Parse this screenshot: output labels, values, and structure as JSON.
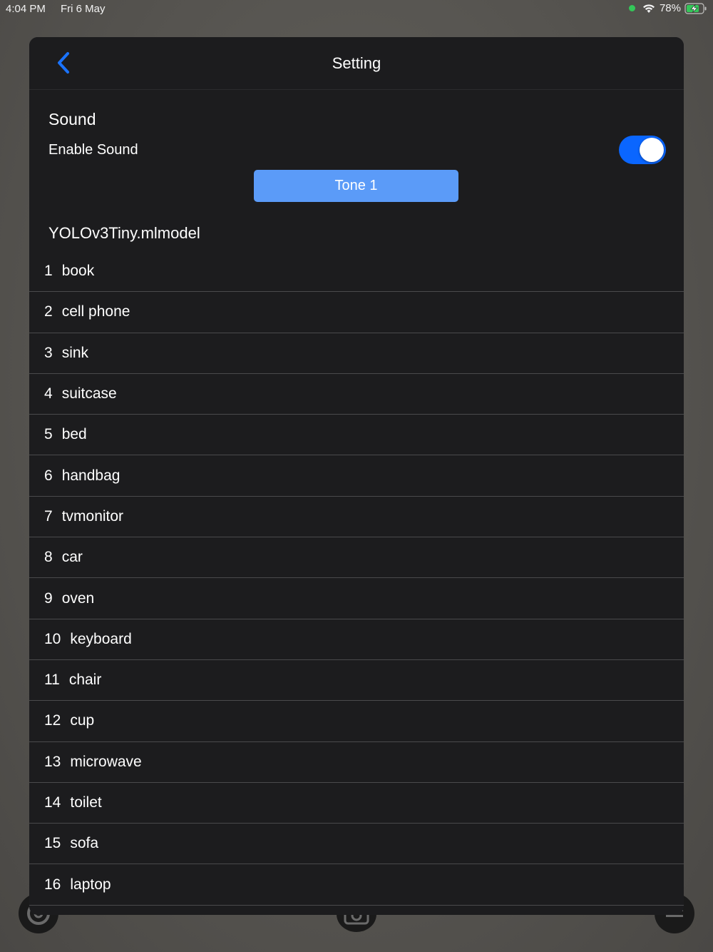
{
  "status_bar": {
    "time": "4:04 PM",
    "date": "Fri 6 May",
    "battery": "78%"
  },
  "nav": {
    "title": "Setting",
    "back_icon": "chevron-left-icon"
  },
  "sound": {
    "section_title": "Sound",
    "enable_label": "Enable Sound",
    "enabled": true,
    "tone_button": "Tone 1"
  },
  "model": {
    "title": "YOLOv3Tiny.mlmodel",
    "items": [
      {
        "num": "1",
        "label": "book"
      },
      {
        "num": "2",
        "label": "cell phone"
      },
      {
        "num": "3",
        "label": "sink"
      },
      {
        "num": "4",
        "label": "suitcase"
      },
      {
        "num": "5",
        "label": "bed"
      },
      {
        "num": "6",
        "label": "handbag"
      },
      {
        "num": "7",
        "label": "tvmonitor"
      },
      {
        "num": "8",
        "label": "car"
      },
      {
        "num": "9",
        "label": "oven"
      },
      {
        "num": "10",
        "label": "keyboard"
      },
      {
        "num": "11",
        "label": "chair"
      },
      {
        "num": "12",
        "label": "cup"
      },
      {
        "num": "13",
        "label": "microwave"
      },
      {
        "num": "14",
        "label": "toilet"
      },
      {
        "num": "15",
        "label": "sofa"
      },
      {
        "num": "16",
        "label": "laptop"
      }
    ]
  },
  "colors": {
    "accent": "#0a66ff",
    "button": "#5b9bf8",
    "modal_bg": "#1c1c1e",
    "battery_green": "#34c759"
  }
}
